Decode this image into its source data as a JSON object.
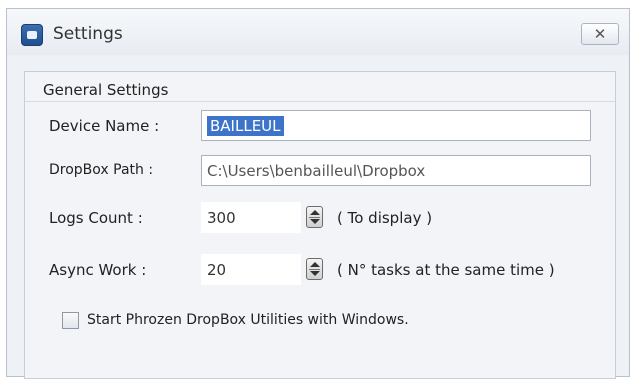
{
  "window": {
    "title": "Settings",
    "close_label": "✕"
  },
  "group": {
    "title": "General Settings"
  },
  "fields": {
    "device_name": {
      "label": "Device Name :",
      "value": "BAILLEUL"
    },
    "dropbox_path": {
      "label": "DropBox Path :",
      "value": "C:\\Users\\benbailleul\\Dropbox"
    },
    "logs_count": {
      "label": "Logs Count  :",
      "value": "300",
      "hint": "( To display )"
    },
    "async_work": {
      "label": "Async Work  :",
      "value": "20",
      "hint": "( N° tasks at the same time )"
    }
  },
  "startup": {
    "label": "Start Phrozen DropBox Utilities with Windows.",
    "checked": false
  }
}
